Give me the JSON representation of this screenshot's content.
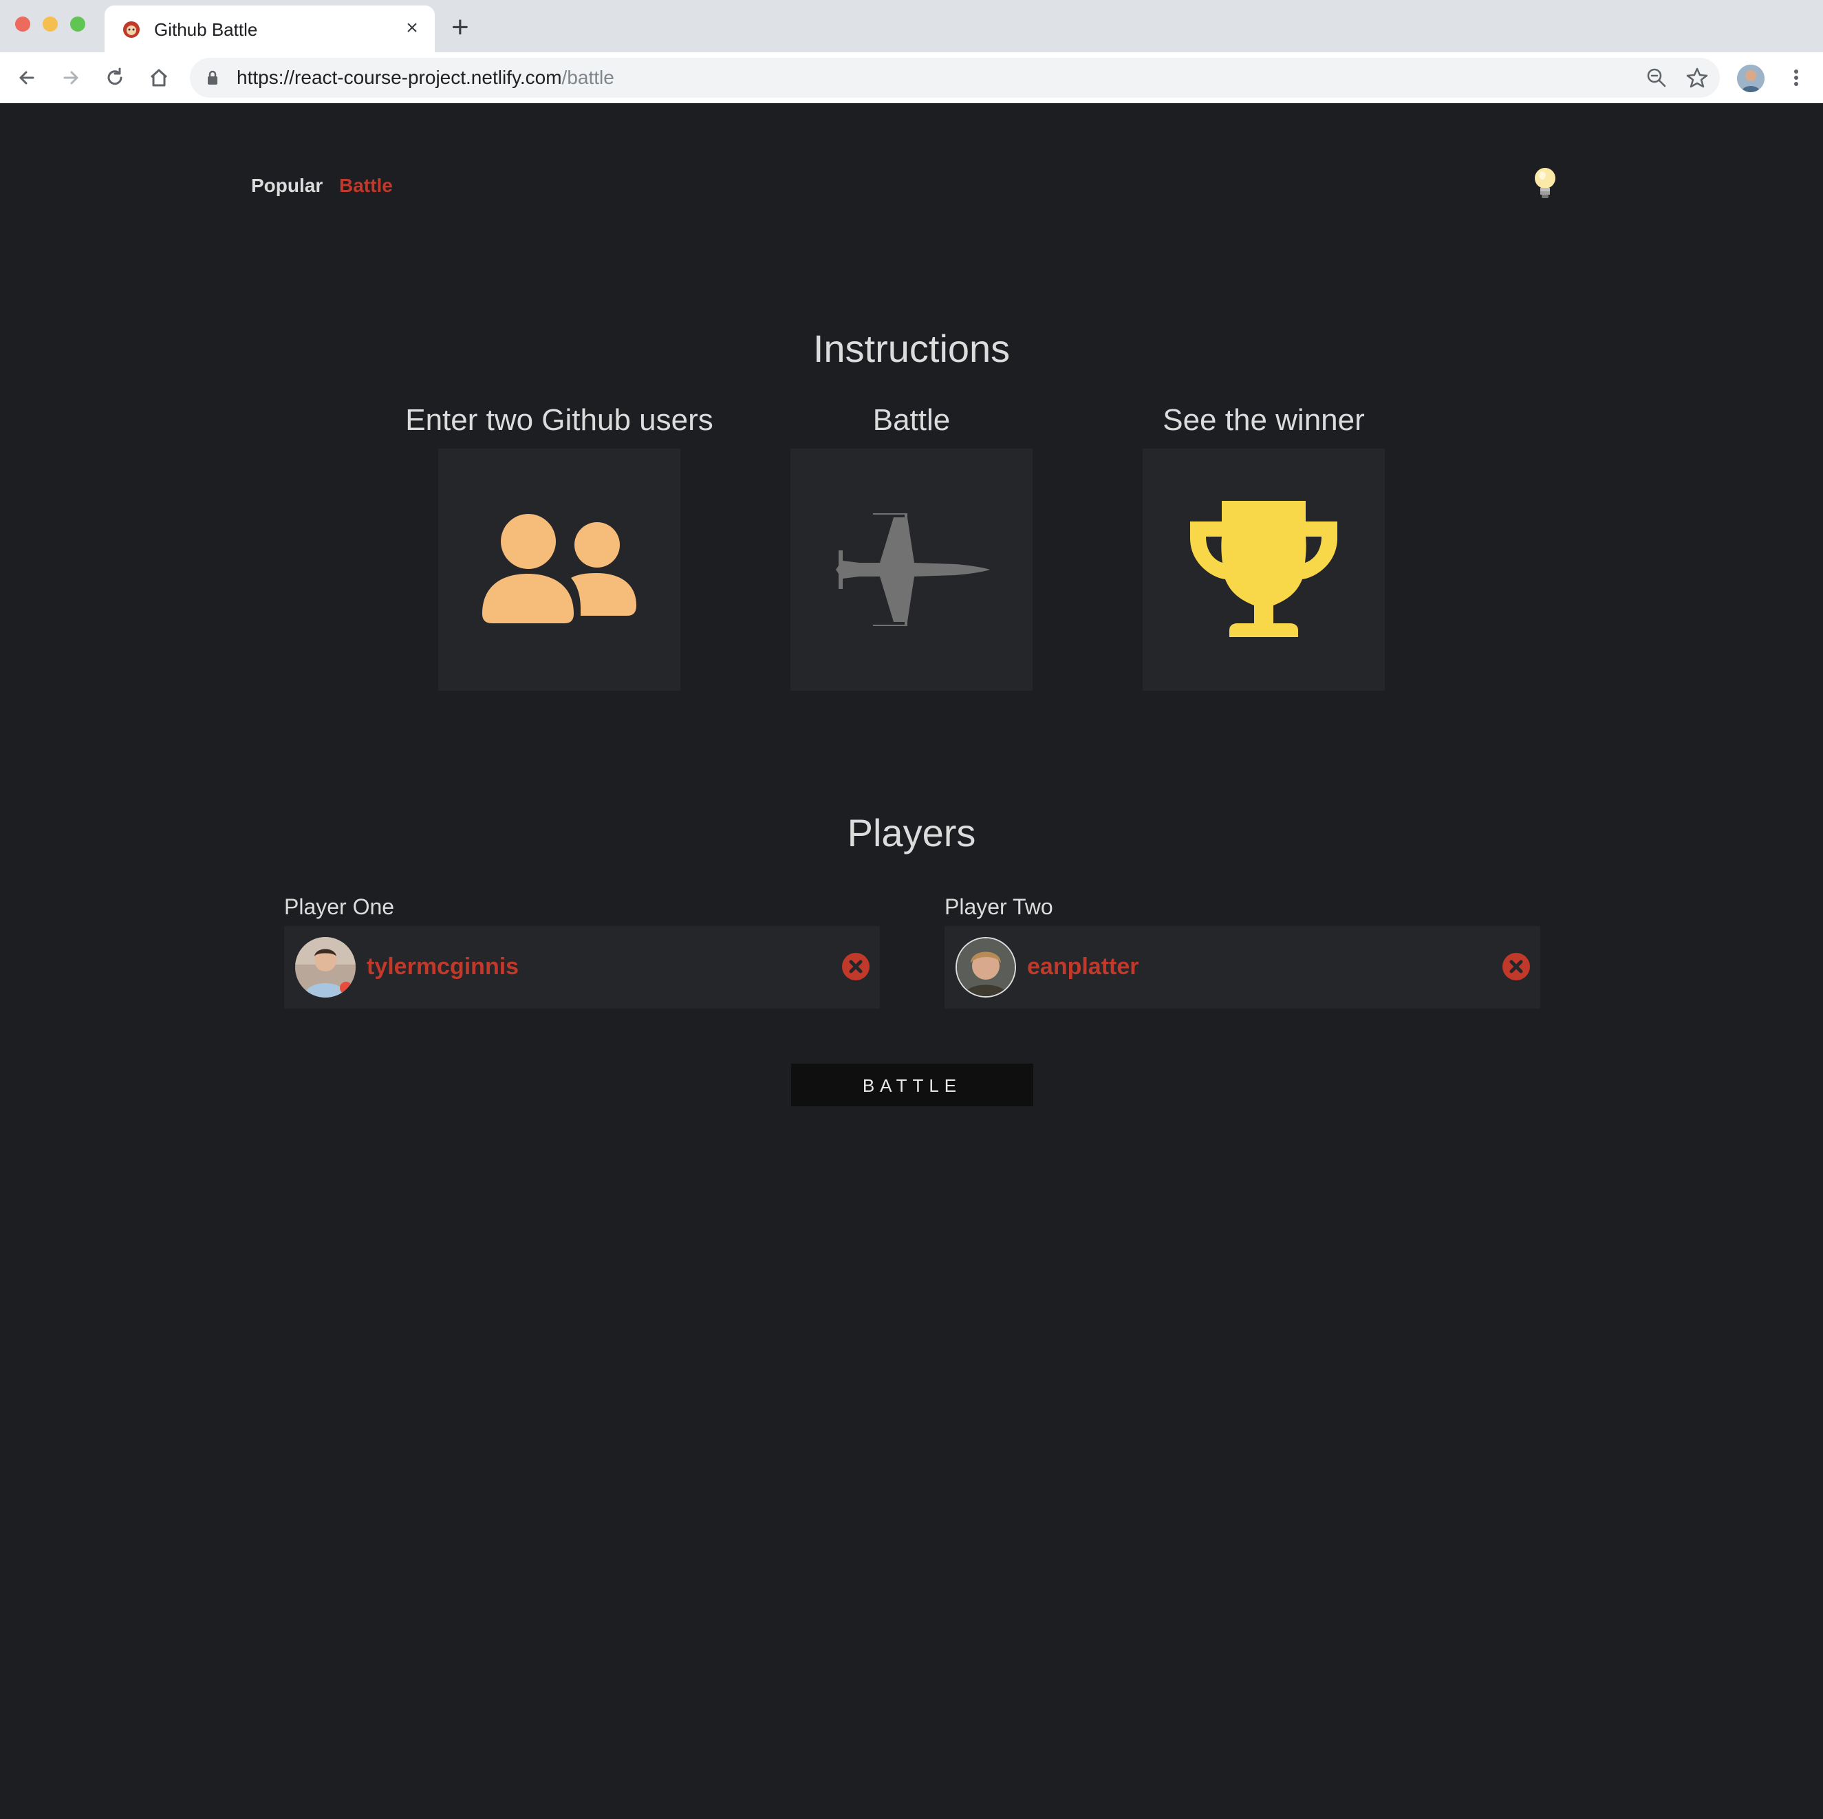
{
  "browser": {
    "tab_title": "Github Battle",
    "url_host": "https://react-course-project.netlify.com",
    "url_path": "/battle"
  },
  "nav": {
    "items": [
      {
        "label": "Popular",
        "active": false
      },
      {
        "label": "Battle",
        "active": true
      }
    ],
    "theme_toggle_icon": "lightbulb-icon"
  },
  "instructions": {
    "title": "Instructions",
    "steps": [
      {
        "label": "Enter two Github users",
        "icon": "users-icon",
        "color": "#f6bc7a"
      },
      {
        "label": "Battle",
        "icon": "fighter-jet-icon",
        "color": "#727272"
      },
      {
        "label": "See the winner",
        "icon": "trophy-icon",
        "color": "#f8d748"
      }
    ]
  },
  "players": {
    "title": "Players",
    "one": {
      "label": "Player One",
      "username": "tylermcginnis"
    },
    "two": {
      "label": "Player Two",
      "username": "eanplatter"
    }
  },
  "battle_button": "BATTLE",
  "colors": {
    "background": "#1c1e21",
    "card": "#242629",
    "accent": "#c0392b",
    "text": "#dcdcdc"
  }
}
